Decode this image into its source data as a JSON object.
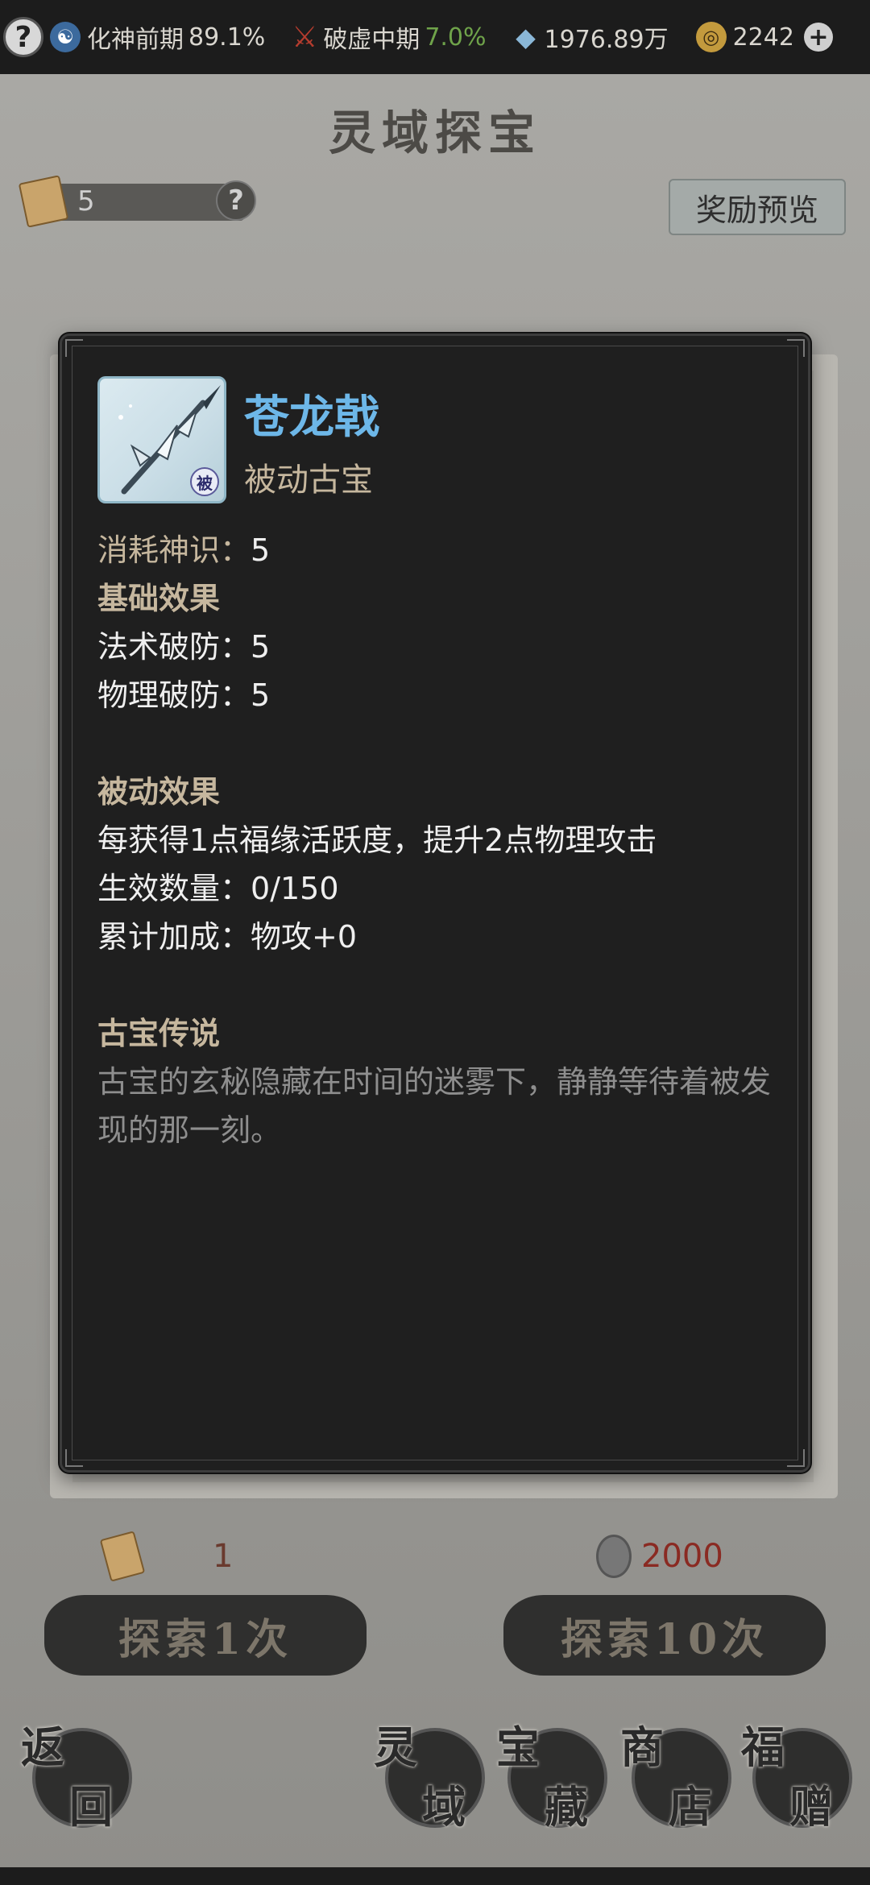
{
  "status_bar": {
    "realm": {
      "name": "化神前期",
      "percent": "89.1%"
    },
    "break": {
      "name": "破虚中期",
      "percent": "7.0%"
    },
    "spirit_stones": "1976.89万",
    "gold": "2242",
    "icons": [
      "help-icon",
      "taiji-icon",
      "sword-icon",
      "gem-icon",
      "gold-coin-icon",
      "plus-icon"
    ]
  },
  "page": {
    "title": "灵域探宝",
    "token_count": "5",
    "reward_preview_label": "奖励预览"
  },
  "modal": {
    "item_name": "苍龙戟",
    "item_type": "被动古宝",
    "passive_badge": "被",
    "consume_label": "消耗神识：",
    "consume_value": "5",
    "basic_header": "基础效果",
    "magic_pen_label": "法术破防：",
    "magic_pen_value": "5",
    "phys_pen_label": "物理破防：",
    "phys_pen_value": "5",
    "passive_header": "被动效果",
    "passive_desc": "每获得1点福缘活跃度，提升2点物理攻击",
    "effect_count_label": "生效数量：",
    "effect_count_value": "0/150",
    "total_bonus_label": "累计加成：",
    "total_bonus_value": "物攻+0",
    "lore_header": "古宝传说",
    "lore_text": "古宝的玄秘隐藏在时间的迷雾下，静静等待着被发现的那一刻。"
  },
  "explore": {
    "cost_single": "1",
    "cost_ten": "2000",
    "btn_single": "探索1次",
    "btn_ten": "探索10次"
  },
  "nav": {
    "back": [
      "返",
      "回"
    ],
    "spirit_realm": [
      "灵",
      "域"
    ],
    "treasure": [
      "宝",
      "藏"
    ],
    "shop": [
      "商",
      "店"
    ],
    "gift": [
      "福",
      "赠"
    ]
  },
  "colors": {
    "accent_blue": "#6db7e8",
    "label_gold": "#c6b79e",
    "green": "#6fa34a",
    "red_cost": "#8a2a22"
  }
}
